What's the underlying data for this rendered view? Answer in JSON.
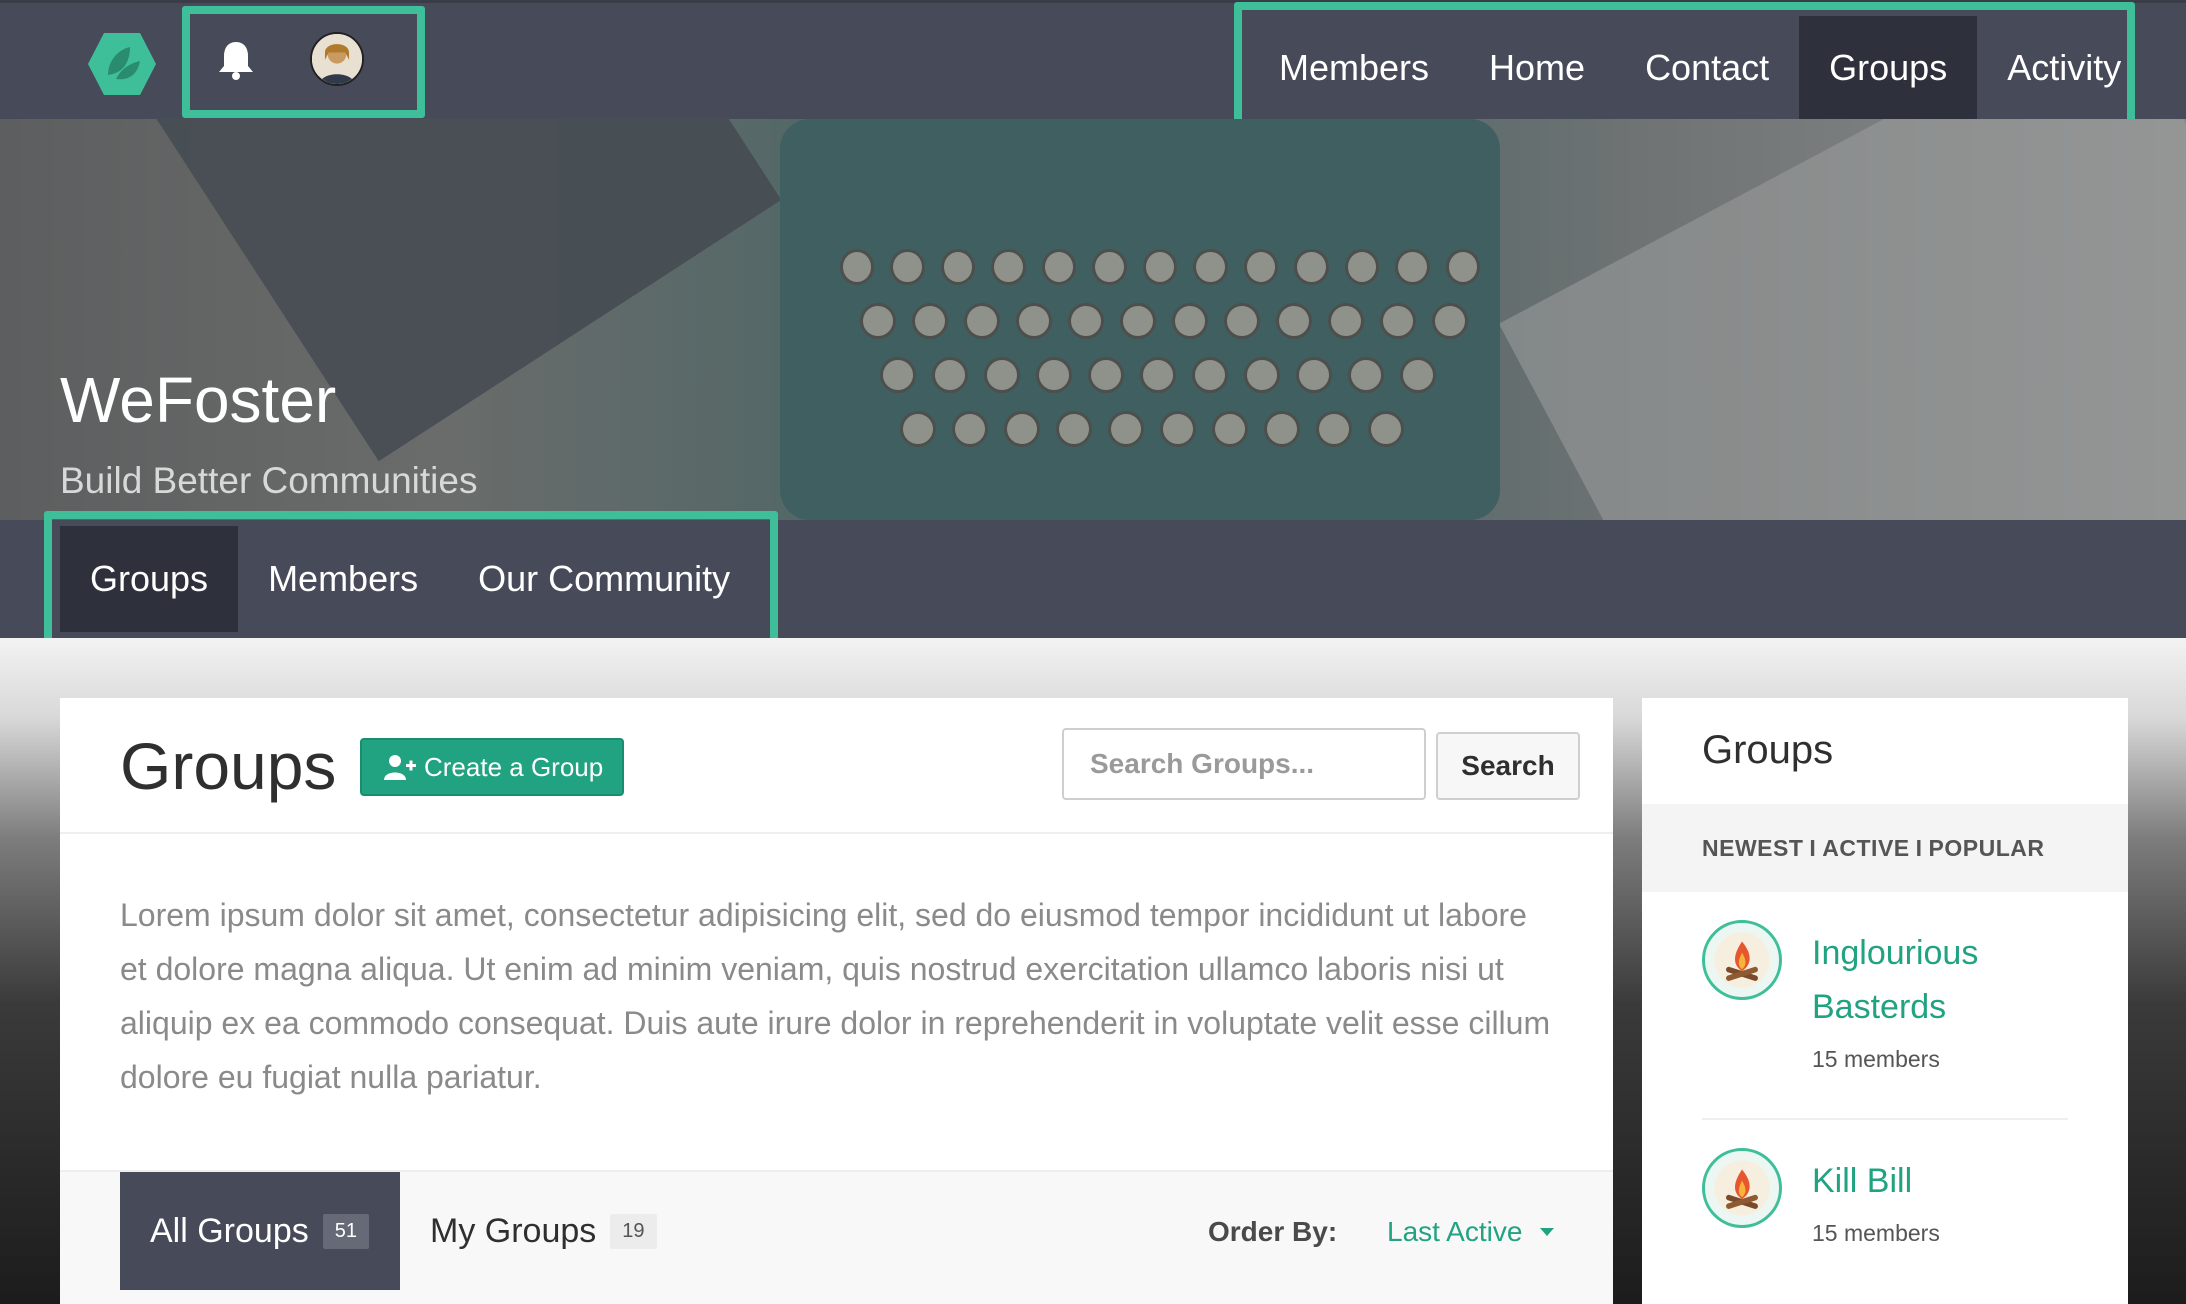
{
  "topnav": {
    "items": [
      {
        "label": "Members",
        "active": false
      },
      {
        "label": "Home",
        "active": false
      },
      {
        "label": "Contact",
        "active": false
      },
      {
        "label": "Groups",
        "active": true
      },
      {
        "label": "Activity",
        "active": false
      }
    ]
  },
  "hero": {
    "title": "WeFoster",
    "subtitle": "Build Better Communities"
  },
  "subnav": {
    "items": [
      {
        "label": "Groups",
        "active": true
      },
      {
        "label": "Members",
        "active": false
      },
      {
        "label": "Our Community",
        "active": false
      }
    ]
  },
  "main": {
    "title": "Groups",
    "create_label": "Create a Group",
    "search_placeholder": "Search Groups...",
    "search_button": "Search",
    "description": "Lorem ipsum dolor sit amet, consectetur adipisicing elit, sed do eiusmod tempor incididunt ut labore et dolore magna aliqua. Ut enim ad minim veniam, quis nostrud exercitation ullamco laboris nisi ut aliquip ex ea commodo consequat. Duis aute irure dolor in reprehenderit in voluptate velit esse cillum dolore eu fugiat nulla pariatur.",
    "tabs": [
      {
        "label": "All Groups",
        "count": "51"
      },
      {
        "label": "My Groups",
        "count": "19"
      }
    ],
    "order_label": "Order By:",
    "order_value": "Last Active"
  },
  "sidebar": {
    "title": "Groups",
    "filters": [
      "NEWEST",
      "ACTIVE",
      "POPULAR"
    ],
    "separator": "I",
    "groups": [
      {
        "name": "Inglourious Basterds",
        "members": "15 members"
      },
      {
        "name": "Kill Bill",
        "members": "15 members"
      }
    ]
  },
  "colors": {
    "accent": "#21a382",
    "highlight": "#3fbf99",
    "navbar": "#474b59",
    "nav_active": "#2e313b"
  },
  "icons": [
    "hexagon-leaf-logo-icon",
    "bell-icon",
    "avatar",
    "add-user-icon",
    "caret-down-icon",
    "campfire-icon"
  ]
}
